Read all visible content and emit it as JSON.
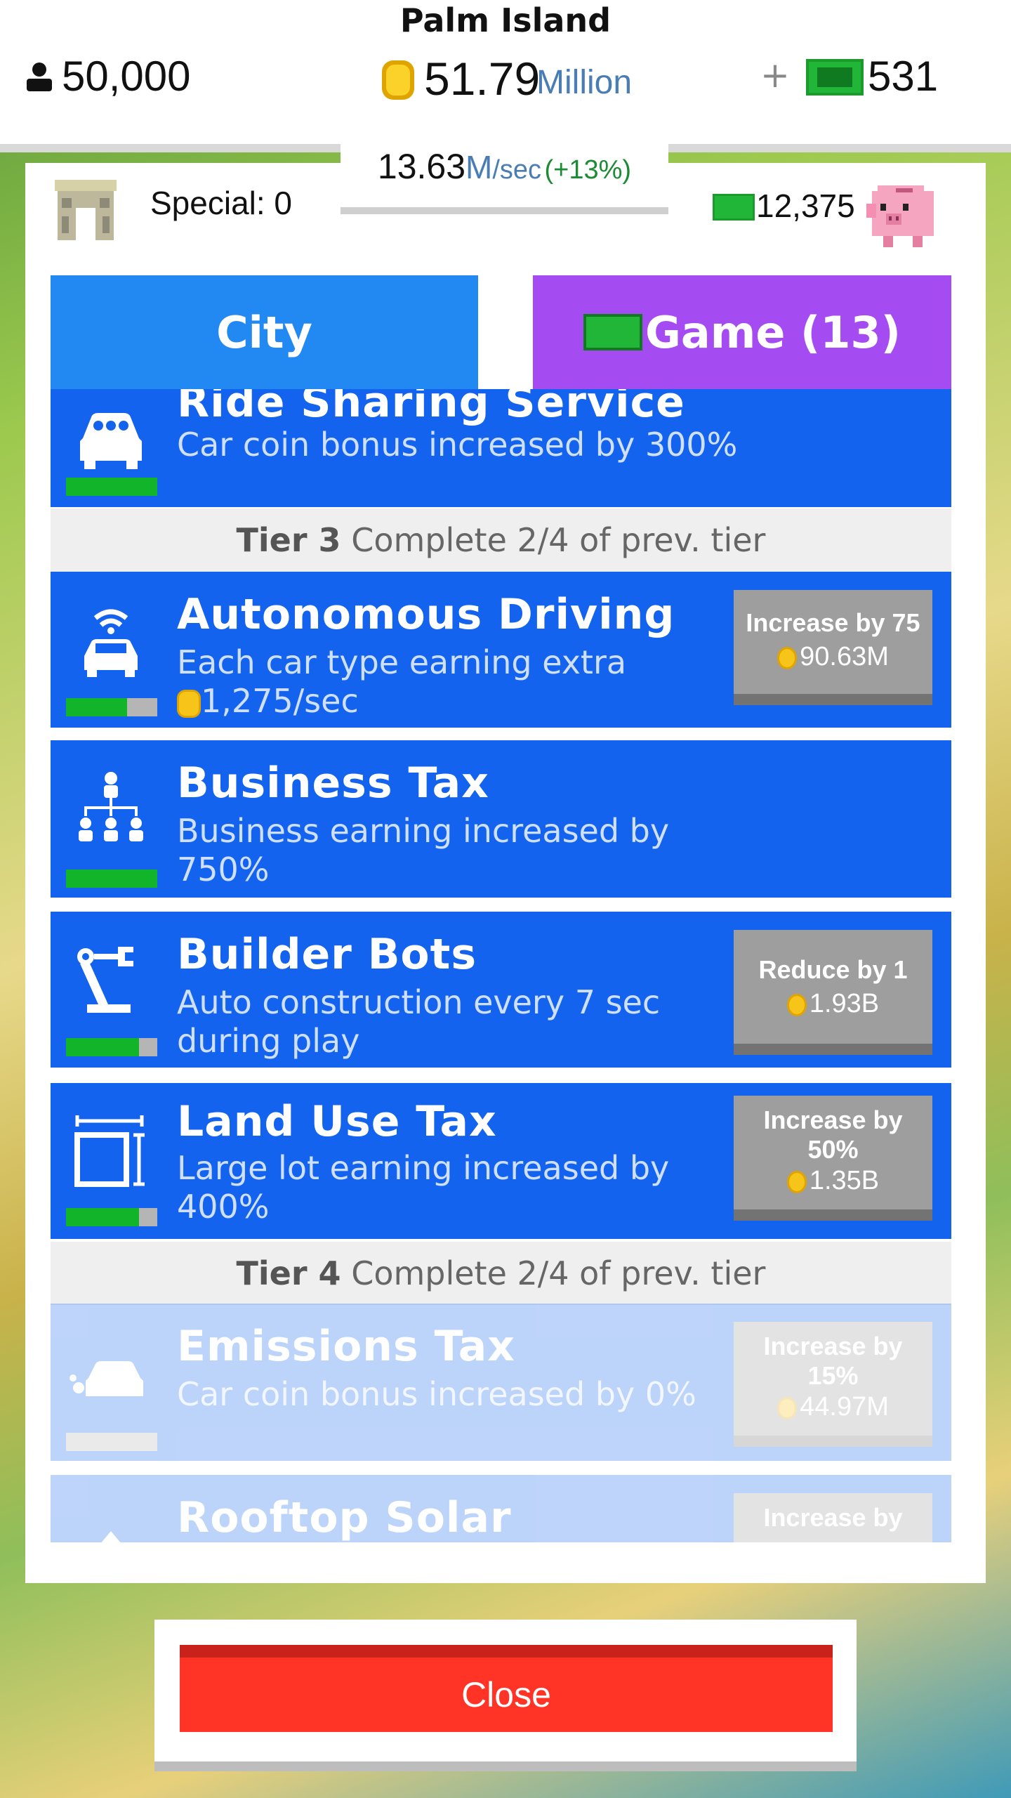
{
  "header": {
    "island_name": "Palm Island",
    "population": "50,000",
    "cash_value": "51.79",
    "cash_unit": "Million",
    "plus_label": "+",
    "gems": "531"
  },
  "panel": {
    "special_label": "Special: 0",
    "rate_value": "13.63",
    "rate_unit": "M",
    "rate_unit2": "/sec",
    "rate_bonus": "(+13%)",
    "bank_value": "12,375"
  },
  "tabs": {
    "city": "City",
    "game": "Game (13)"
  },
  "list": {
    "ride_sharing": {
      "name": "Ride Sharing Service",
      "desc": "Car coin bonus increased by 300%",
      "progress": 1.0
    },
    "tier3": {
      "label": "Tier 3",
      "req": "Complete 2/4 of prev. tier"
    },
    "autonomous": {
      "name": "Autonomous Driving",
      "desc1": "Each car type earning extra",
      "desc2": "1,275/sec",
      "upgrade_label": "Increase by 75",
      "upgrade_price": "90.63M",
      "progress": 0.67
    },
    "business_tax": {
      "name": "Business Tax",
      "desc1": "Business earning increased by",
      "desc2": "750%",
      "progress": 1.0
    },
    "builder_bots": {
      "name": "Builder Bots",
      "desc1": "Auto construction every 7 sec",
      "desc2": "during play",
      "upgrade_label": "Reduce by 1",
      "upgrade_price": "1.93B",
      "progress": 0.8
    },
    "land_use_tax": {
      "name": "Land Use Tax",
      "desc": "Large lot earning increased by 400%",
      "upgrade_label1": "Increase by",
      "upgrade_label2": "50%",
      "upgrade_price": "1.35B",
      "progress": 0.8
    },
    "tier4": {
      "label": "Tier 4",
      "req": "Complete 2/4 of prev. tier"
    },
    "emissions_tax": {
      "name": "Emissions Tax",
      "desc": "Car coin bonus increased by 0%",
      "upgrade_label1": "Increase by",
      "upgrade_label2": "15%",
      "upgrade_price": "44.97M",
      "progress": 0
    },
    "rooftop_solar": {
      "name": "Rooftop Solar",
      "upgrade_label1": "Increase by"
    }
  },
  "close_label": "Close",
  "colors": {
    "accent_blue": "#1463ee",
    "tab_city": "#2389f2",
    "tab_game": "#a44cf2",
    "progress_green": "#12b42a",
    "close_red": "#ff3326"
  }
}
